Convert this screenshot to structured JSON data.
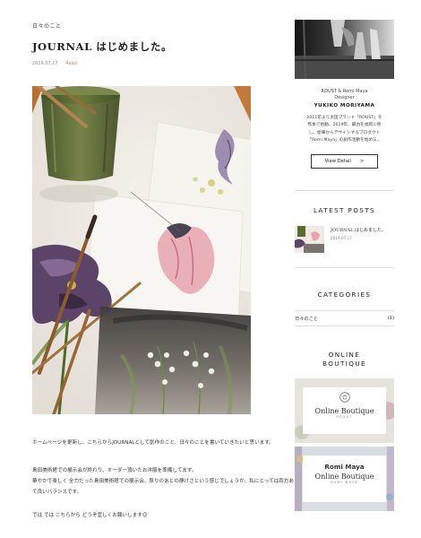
{
  "post": {
    "category": "日々のこと",
    "title": "JOURNAL はじめました。",
    "date": "2019.07.17",
    "tag": "Read",
    "paragraphs": [
      "ホームページを更新し、こちらからJOURNALとして創作のこと、日々のことを書いていきたいと思います。",
      "島田美術館での展示会が終わり、オーダー頂いたお洋服を準備してます。",
      "華やかで楽しく 全力だった島田美術館での展示会、祭りのあとの静けさという感じでしょうか。私にとっては両方あって良いバランスです。",
      "では では こちらから どうぞ宜しくお願いします😊"
    ]
  },
  "sidebar": {
    "profile": {
      "role_line1": "ROUST & Romi Maya",
      "role_line2": "Designer",
      "name": "YUKIKO MORIYAMA",
      "bio_line1": "2011年より太田ブランド「ROUST」を",
      "bio_line2": "熊本で始動。2019年、最古を福岡に移",
      "bio_line3": "し、絵筆からデザインするプロダクト",
      "bio_line4": "「Romi Maya」の創作活動を始める。",
      "button_label": "View Detail",
      "button_arrow": ">"
    },
    "latest": {
      "heading": "LATEST POSTS",
      "items": [
        {
          "title": "JOURNAL はじめました。",
          "date": "2019.07.17"
        }
      ]
    },
    "categories": {
      "heading": "CATEGORIES",
      "items": [
        {
          "name": "日々のこと",
          "count": "(1)"
        }
      ]
    },
    "boutique": {
      "heading_line1": "ONLINE",
      "heading_line2": "BOUTIQUE",
      "banner1": {
        "title": "Online Boutique",
        "sub": "ROUST"
      },
      "banner2": {
        "title_line1": "Romi Maya",
        "title_line2": "Online Boutique",
        "sub": "ROMI MAYA"
      }
    }
  },
  "colors": {
    "accent": "#e07b5a",
    "text": "#333333",
    "divider": "#dddddd"
  }
}
